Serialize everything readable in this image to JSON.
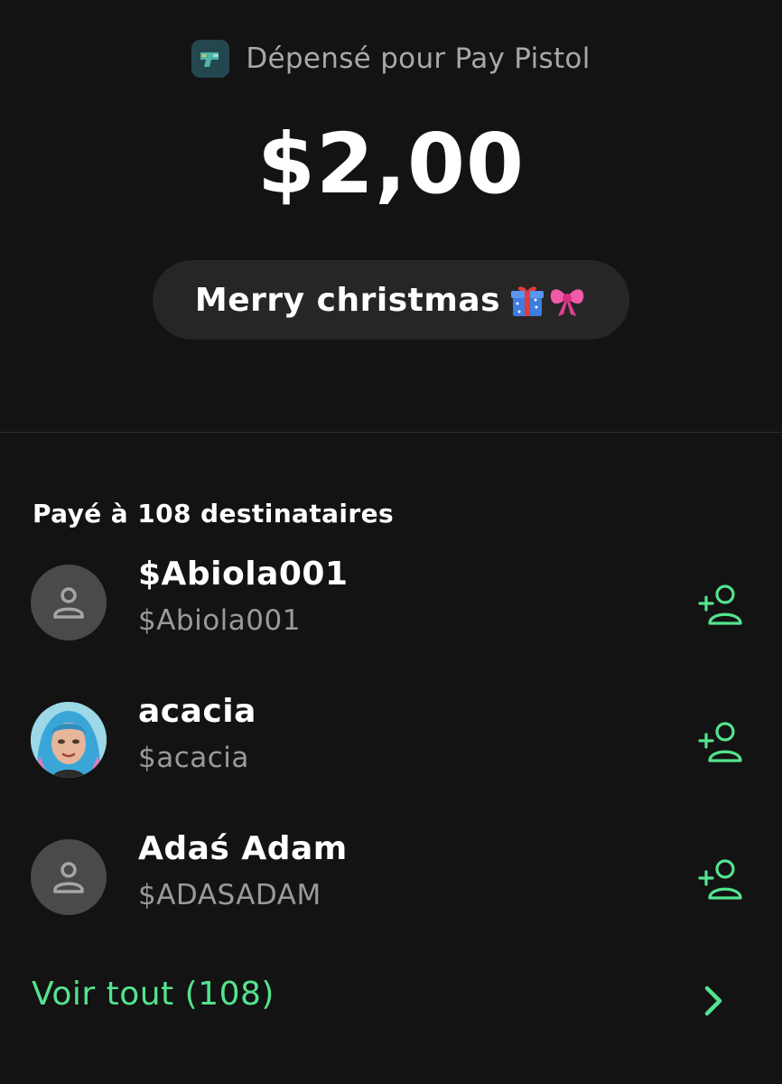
{
  "merchant": {
    "title": "Dépensé pour Pay Pistol",
    "logo_icon": "pay-pistol-logo"
  },
  "payment": {
    "amount": "$2,00",
    "note": "Merry christmas",
    "note_emojis": [
      "gift-emoji",
      "ribbon-emoji"
    ]
  },
  "recipients_section": {
    "title": "Payé à 108 destinataires",
    "items": [
      {
        "name": "$Abiola001",
        "handle": "$Abiola001",
        "avatar": "default-person-icon",
        "action_icon": "add-contact-icon"
      },
      {
        "name": "acacia",
        "handle": "$acacia",
        "avatar": "photo-avatar",
        "action_icon": "add-contact-icon"
      },
      {
        "name": "Adaś Adam",
        "handle": "$ADASADAM",
        "avatar": "default-person-icon",
        "action_icon": "add-contact-icon"
      }
    ],
    "see_all_label": "Voir tout (108)"
  },
  "colors": {
    "background": "#131313",
    "accent_green": "#54e38f",
    "pill_background": "#262626",
    "secondary_text": "#9a9a9a"
  }
}
